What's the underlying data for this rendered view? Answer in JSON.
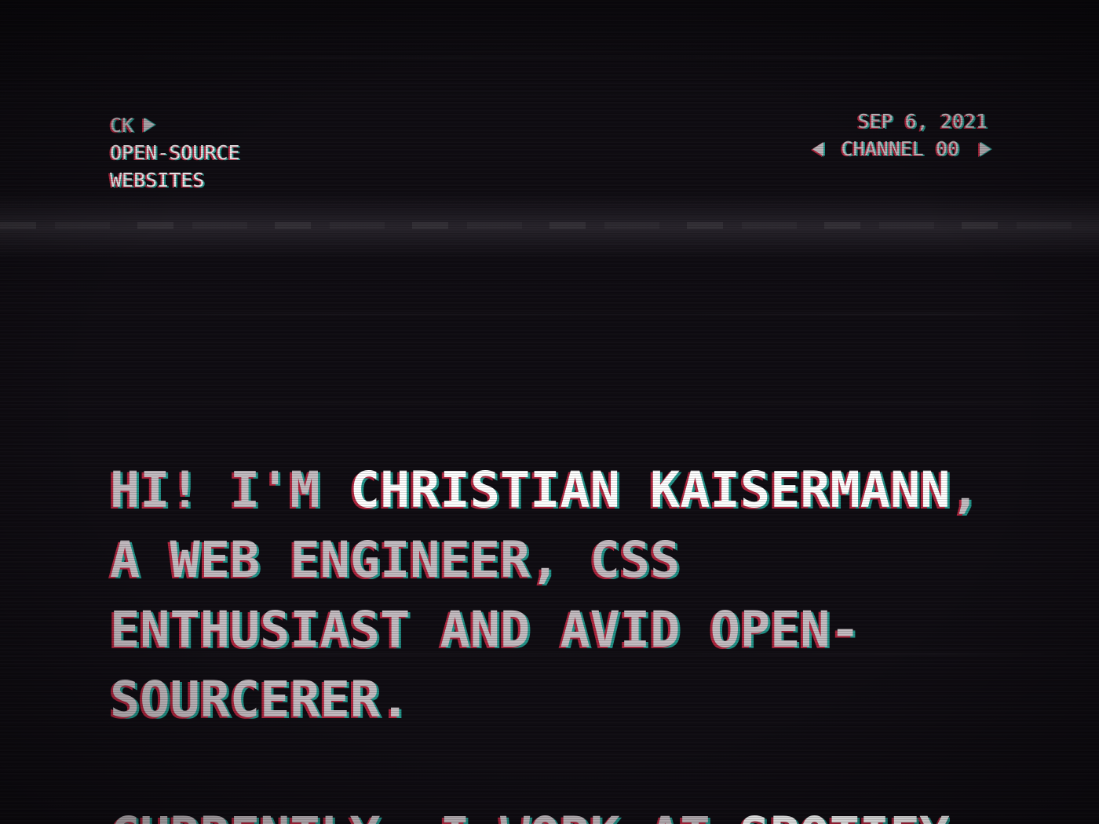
{
  "header": {
    "logo": {
      "label": "CK",
      "icon": "play-icon"
    },
    "nav": [
      {
        "label": "OPEN-SOURCE"
      },
      {
        "label": "WEBSITES"
      }
    ],
    "date": "SEP 6, 2021",
    "channel": {
      "label": "CHANNEL 00",
      "prev_icon": "triangle-left-icon",
      "next_icon": "triangle-right-icon"
    }
  },
  "intro": {
    "greeting": "HI! I'M ",
    "name": "CHRISTIAN KAISERMANN",
    "description": ", A WEB ENGINEER, CSS ENTHUSIAST AND AVID OPEN-SOURCERER."
  },
  "current_work": {
    "text": "CURRENTLY, I WORK AT",
    "company": "SPOTIFY"
  },
  "colors": {
    "background": "#0f0c12",
    "text": "#c4bcc1",
    "text_bright": "#f2eef0",
    "text_dim": "#bbb4b9",
    "highlight": "#ffffff",
    "fringe_red": "#b0263f",
    "fringe_cyan": "#22958a"
  }
}
